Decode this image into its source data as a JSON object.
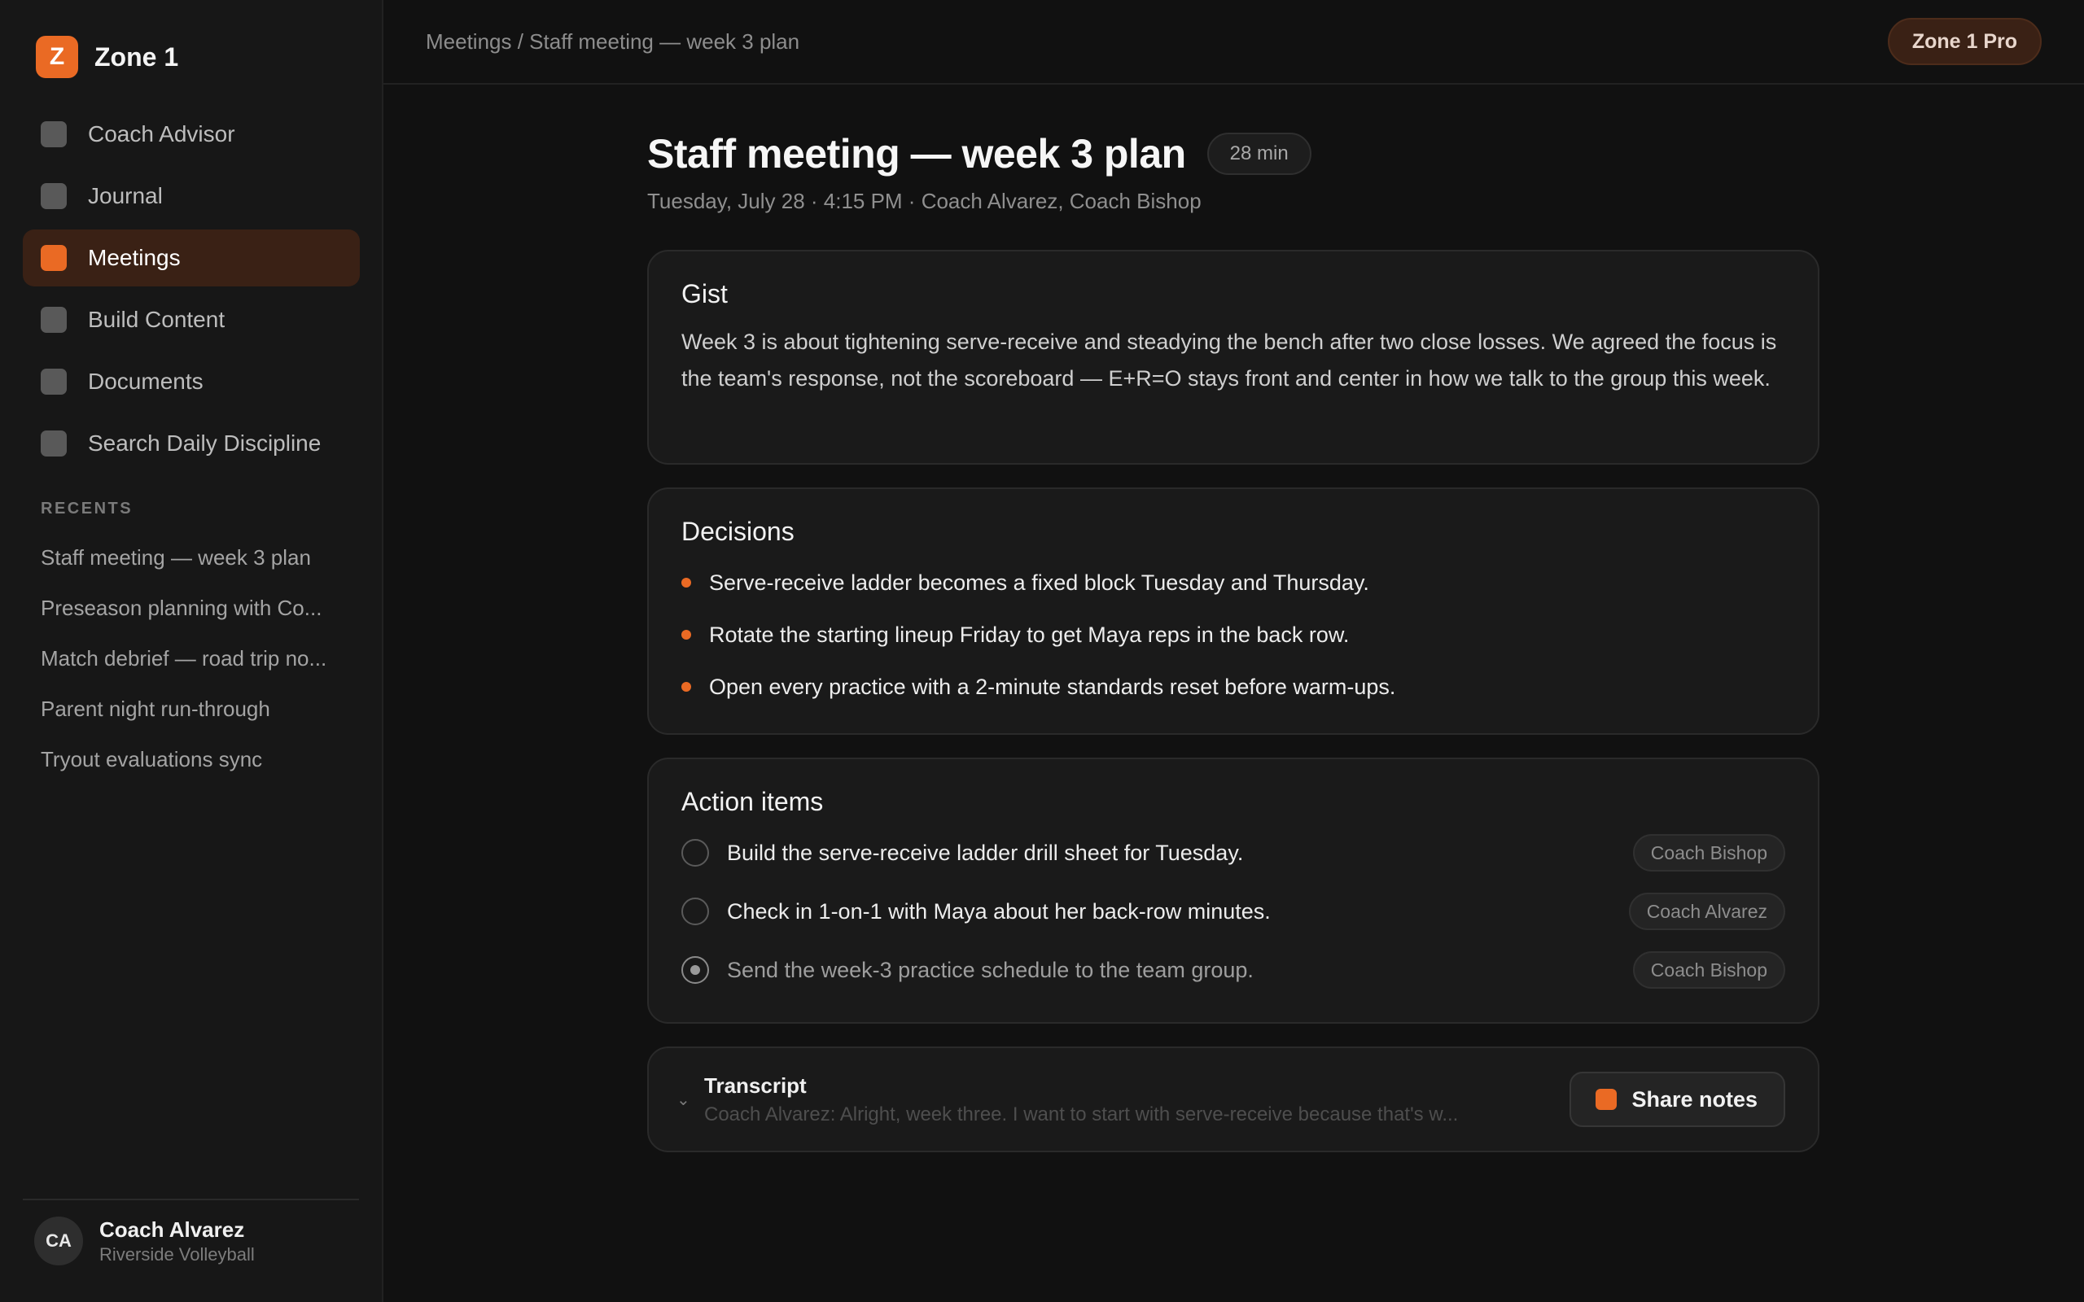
{
  "brand": {
    "logo_letter": "Z",
    "name": "Zone 1",
    "accent": "#ea6a24"
  },
  "nav": [
    {
      "label": "Coach Advisor",
      "active": false
    },
    {
      "label": "Journal",
      "active": false
    },
    {
      "label": "Meetings",
      "active": true
    },
    {
      "label": "Build Content",
      "active": false
    },
    {
      "label": "Documents",
      "active": false
    },
    {
      "label": "Search Daily Discipline",
      "active": false
    }
  ],
  "recents": {
    "heading": "RECENTS",
    "items": [
      "Staff meeting — week 3 plan",
      "Preseason planning with Co...",
      "Match debrief — road trip no...",
      "Parent night run-through",
      "Tryout evaluations sync"
    ]
  },
  "user": {
    "initials": "CA",
    "name": "Coach Alvarez",
    "org": "Riverside Volleyball"
  },
  "topbar": {
    "breadcrumb": "Meetings / Staff meeting — week 3 plan",
    "plan_badge": "Zone 1 Pro"
  },
  "meeting": {
    "title": "Staff meeting — week 3 plan",
    "duration": "28 min",
    "meta": "Tuesday, July 28 · 4:15 PM · Coach Alvarez, Coach Bishop"
  },
  "gist": {
    "heading": "Gist",
    "text": "Week 3 is about tightening serve-receive and steadying the bench after two close losses. We agreed the focus is the team's response, not the scoreboard — E+R=O stays front and center in how we talk to the group this week."
  },
  "decisions": {
    "heading": "Decisions",
    "items": [
      "Serve-receive ladder becomes a fixed block Tuesday and Thursday.",
      "Rotate the starting lineup Friday to get Maya reps in the back row.",
      "Open every practice with a 2-minute standards reset before warm-ups."
    ]
  },
  "actions": {
    "heading": "Action items",
    "items": [
      {
        "text": "Build the serve-receive ladder drill sheet for Tuesday.",
        "assignee": "Coach Bishop",
        "done": false
      },
      {
        "text": "Check in 1-on-1 with Maya about her back-row minutes.",
        "assignee": "Coach Alvarez",
        "done": false
      },
      {
        "text": "Send the week-3 practice schedule to the team group.",
        "assignee": "Coach Bishop",
        "done": true
      }
    ]
  },
  "transcript": {
    "heading": "Transcript",
    "preview": "Coach Alvarez: Alright, week three. I want to start with serve-receive because that's w...",
    "chevron": "chevron-down-icon"
  },
  "share": {
    "label": "Share notes"
  }
}
